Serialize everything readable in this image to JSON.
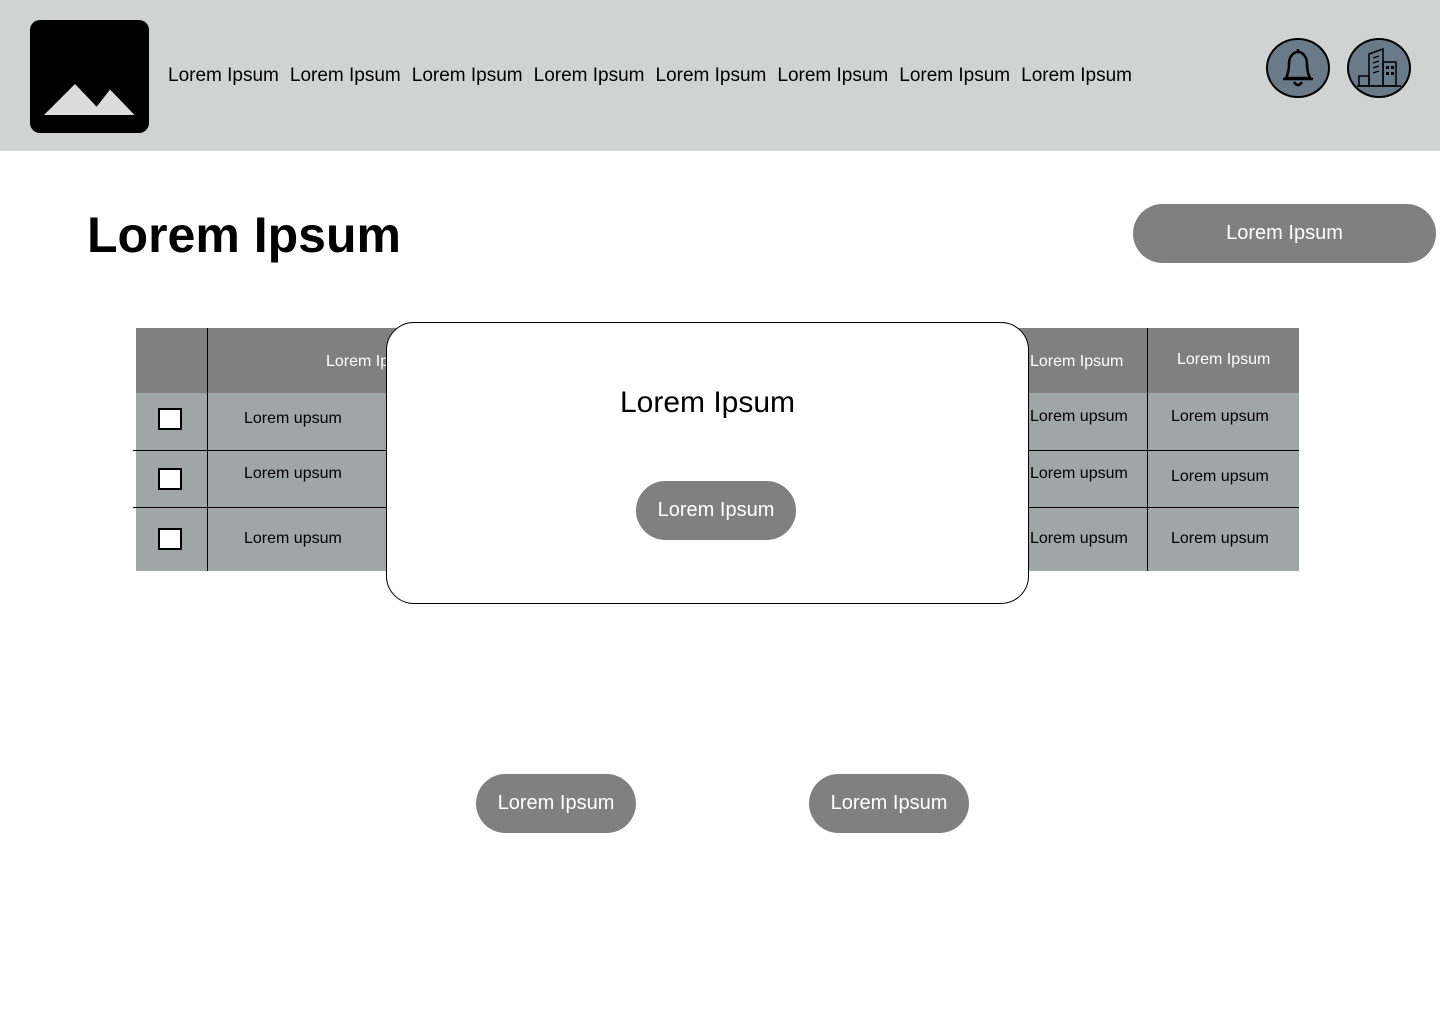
{
  "header": {
    "logo": "image-placeholder-icon",
    "nav": [
      "Lorem Ipsum",
      "Lorem Ipsum",
      "Lorem Ipsum",
      "Lorem Ipsum",
      "Lorem Ipsum",
      "Lorem Ipsum",
      "Lorem Ipsum",
      "Lorem Ipsum"
    ],
    "icons": [
      "bell-icon",
      "building-icon"
    ],
    "icon_color": "#6b7a88",
    "bg_color": "#cfd3d2"
  },
  "page": {
    "title": "Lorem Ipsum",
    "action_label": "Lorem Ipsum"
  },
  "table": {
    "headers": [
      "Lorem Ipsum",
      "Lorem  Ipsum",
      "Lorem Ipsum"
    ],
    "rows": [
      {
        "checked": false,
        "cells": [
          "Lorem upsum",
          "Lorem upsum",
          "Lorem upsum"
        ]
      },
      {
        "checked": false,
        "cells": [
          "Lorem upsum",
          "Lorem upsum",
          "Lorem upsum"
        ]
      },
      {
        "checked": false,
        "cells": [
          "Lorem upsum",
          "Lorem upsum",
          "Lorem upsum"
        ]
      }
    ],
    "header_color": "#808080",
    "row_color": "#9ea7a5"
  },
  "modal": {
    "title": "Lorem Ipsum",
    "button_label": "Lorem Ipsum"
  },
  "footer_buttons": [
    "Lorem Ipsum",
    "Lorem Ipsum"
  ]
}
